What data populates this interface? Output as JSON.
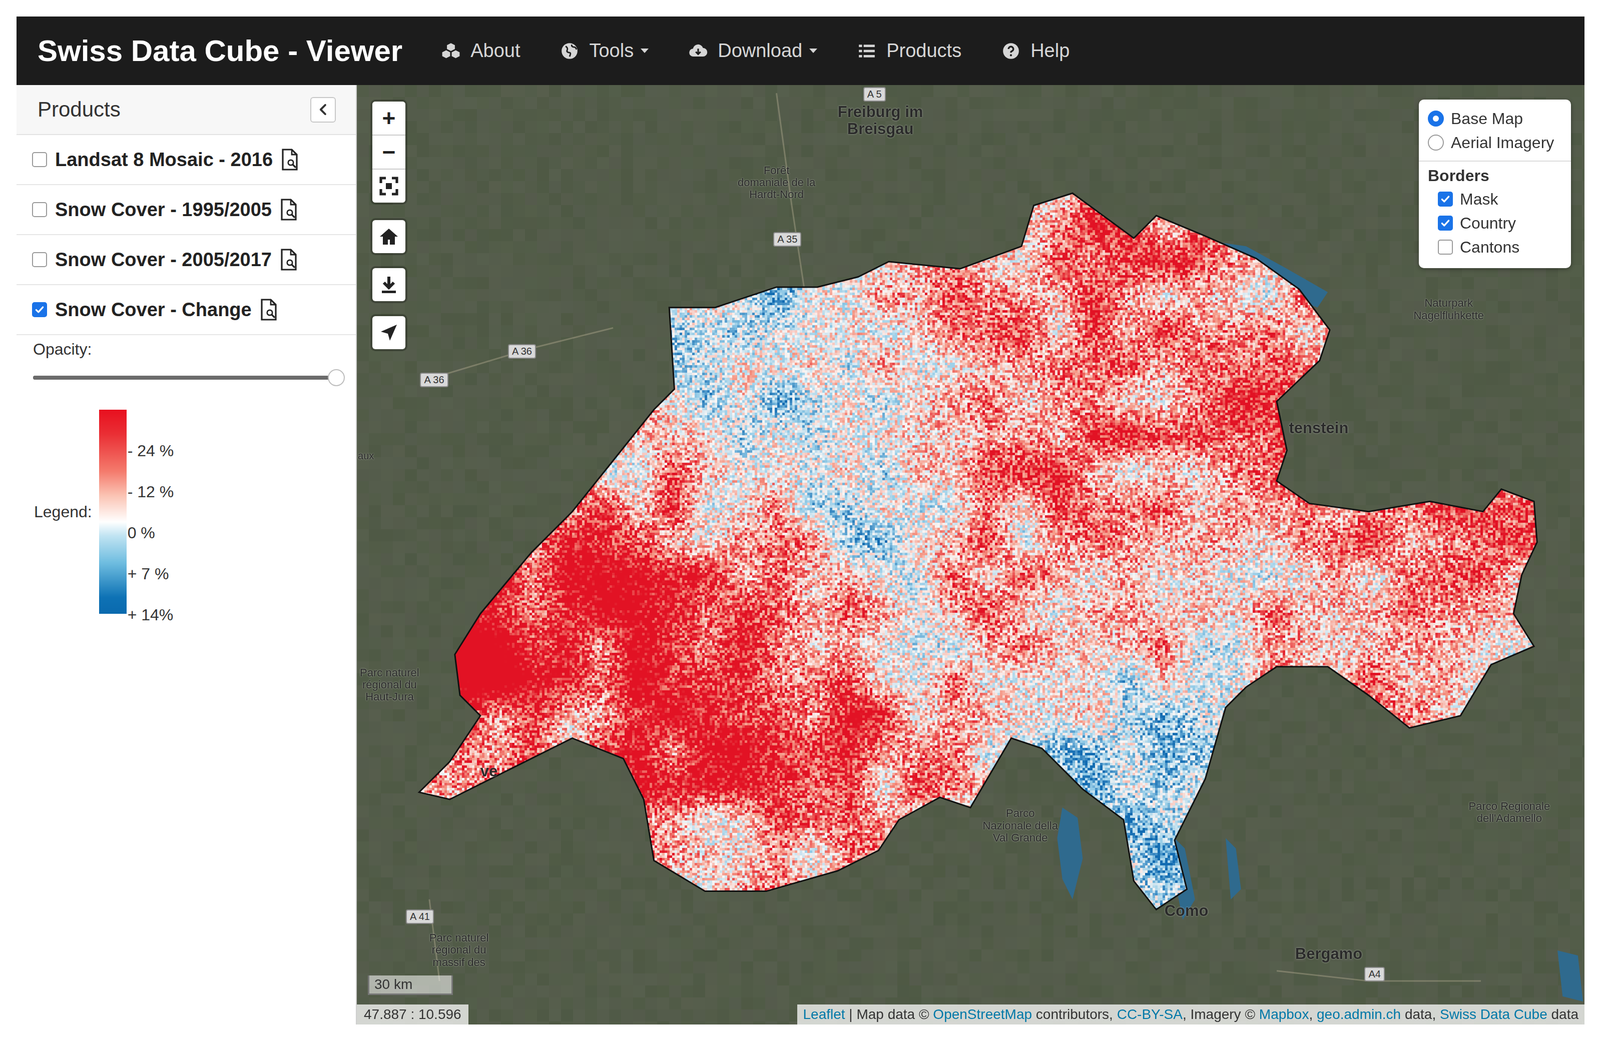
{
  "navbar": {
    "brand": "Swiss Data Cube - Viewer",
    "items": [
      {
        "label": "About",
        "dropdown": false
      },
      {
        "label": "Tools",
        "dropdown": true
      },
      {
        "label": "Download",
        "dropdown": true
      },
      {
        "label": "Products",
        "dropdown": false
      },
      {
        "label": "Help",
        "dropdown": false
      }
    ]
  },
  "sidebar": {
    "title": "Products",
    "items": [
      {
        "label": "Landsat 8 Mosaic - 2016",
        "checked": false
      },
      {
        "label": "Snow Cover - 1995/2005",
        "checked": false
      },
      {
        "label": "Snow Cover - 2005/2017",
        "checked": false
      },
      {
        "label": "Snow Cover - Change",
        "checked": true
      }
    ],
    "opacity": {
      "label": "Opacity:",
      "level": 0.98
    },
    "legend": {
      "label": "Legend:",
      "ticks": [
        "- 24 %",
        "- 12 %",
        "0 %",
        "+ 7 %",
        "+ 14%"
      ]
    }
  },
  "map_controls": {
    "zoom_in": "+",
    "zoom_out": "−"
  },
  "layers": {
    "base": [
      {
        "label": "Base Map",
        "selected": true
      },
      {
        "label": "Aerial Imagery",
        "selected": false
      }
    ],
    "borders_title": "Borders",
    "borders": [
      {
        "label": "Mask",
        "checked": true
      },
      {
        "label": "Country",
        "checked": true
      },
      {
        "label": "Cantons",
        "checked": false
      }
    ]
  },
  "map_labels": [
    {
      "lines": [
        "Freiburg im",
        "Breisgau"
      ],
      "kind": "city"
    },
    {
      "lines": [
        "Forêt",
        "domaniale de la",
        "Hardt-Nord"
      ],
      "kind": "area"
    },
    {
      "lines": [
        "A 5"
      ],
      "kind": "road"
    },
    {
      "lines": [
        "A 35"
      ],
      "kind": "road"
    },
    {
      "lines": [
        "A 36"
      ],
      "kind": "road"
    },
    {
      "lines": [
        "A 36"
      ],
      "kind": "road"
    },
    {
      "lines": [
        "aux"
      ],
      "kind": "area"
    },
    {
      "lines": [
        "Parc naturel",
        "régional du",
        "Haut-Jura"
      ],
      "kind": "area"
    },
    {
      "lines": [
        "tenstein"
      ],
      "kind": "city"
    },
    {
      "lines": [
        "Naturpark",
        "Nagelfluhkette"
      ],
      "kind": "area"
    },
    {
      "lines": [
        "ve"
      ],
      "kind": "city"
    },
    {
      "lines": [
        "Como"
      ],
      "kind": "city"
    },
    {
      "lines": [
        "Bergamo"
      ],
      "kind": "city"
    },
    {
      "lines": [
        "A4"
      ],
      "kind": "road"
    },
    {
      "lines": [
        "A 41"
      ],
      "kind": "road"
    },
    {
      "lines": [
        "Parc naturel",
        "régional du",
        "massif des"
      ],
      "kind": "area"
    },
    {
      "lines": [
        "Parco",
        "Nazionale della",
        "Val Grande"
      ],
      "kind": "area"
    },
    {
      "lines": [
        "Parco Regionale",
        "dell'Adamello"
      ],
      "kind": "area"
    }
  ],
  "scale": "30 km",
  "coordinates": "47.887 : 10.596",
  "attribution": [
    {
      "text": "Leaflet",
      "link": true
    },
    {
      "text": " | Map data © ",
      "link": false
    },
    {
      "text": "OpenStreetMap",
      "link": true
    },
    {
      "text": " contributors, ",
      "link": false
    },
    {
      "text": "CC-BY-SA",
      "link": true
    },
    {
      "text": ", Imagery © ",
      "link": false
    },
    {
      "text": "Mapbox",
      "link": true
    },
    {
      "text": ", ",
      "link": false
    },
    {
      "text": "geo.admin.ch",
      "link": true
    },
    {
      "text": " data, ",
      "link": false
    },
    {
      "text": "Swiss Data Cube",
      "link": true
    },
    {
      "text": " data",
      "link": false
    }
  ]
}
